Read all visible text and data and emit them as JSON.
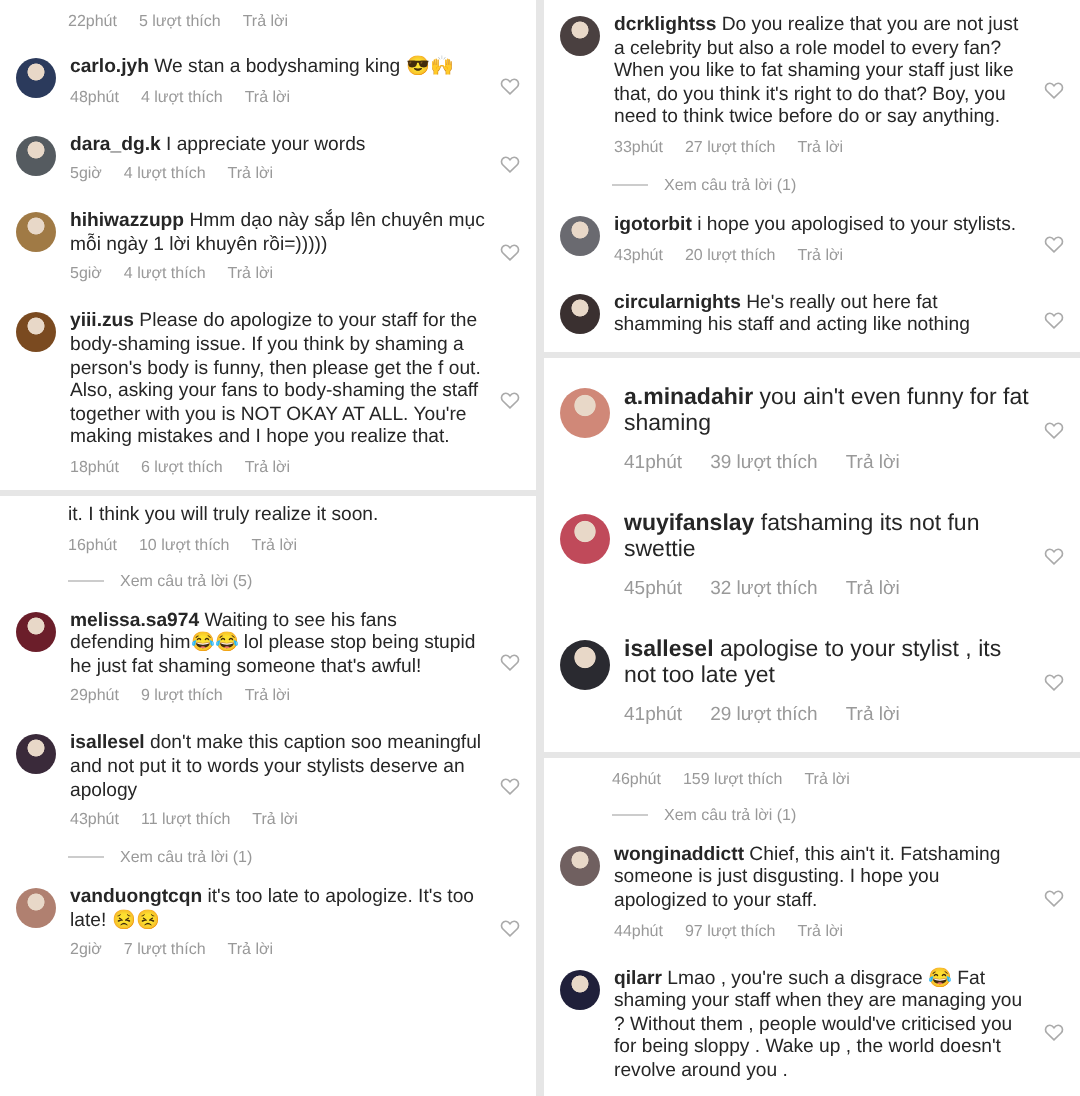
{
  "columns": [
    {
      "panels": [
        {
          "kind": "compact",
          "items": [
            {
              "kind": "meta",
              "time": "22phút",
              "likes": "5 lượt thích",
              "reply": "Trả lời"
            },
            {
              "kind": "comment",
              "user": "carlo.jyh",
              "text": "We stan a bodyshaming king 😎🙌",
              "time": "48phút",
              "likes": "4 lượt thích",
              "reply": "Trả lời"
            },
            {
              "kind": "comment",
              "user": "dara_dg.k",
              "text": "I appreciate your words",
              "time": "5giờ",
              "likes": "4 lượt thích",
              "reply": "Trả lời"
            },
            {
              "kind": "comment",
              "user": "hihiwazzupp",
              "text": "Hmm dạo này sắp lên chuyên mục mỗi ngày 1 lời khuyên rồi=)))))",
              "time": "5giờ",
              "likes": "4 lượt thích",
              "reply": "Trả lời"
            },
            {
              "kind": "comment",
              "user": "yiii.zus",
              "text": "Please do apologize to your staff for the body-shaming issue. If you think by shaming a person's body is funny, then please get the f out. Also, asking your fans to body-shaming the staff together with you is NOT OKAY AT ALL. You're making mistakes and I hope you realize that.",
              "time": "18phút",
              "likes": "6 lượt thích",
              "reply": "Trả lời"
            }
          ]
        },
        {
          "kind": "compact",
          "items": [
            {
              "kind": "fragment",
              "text": "it. I think you will truly realize it soon.",
              "time": "16phút",
              "likes": "10 lượt thích",
              "reply": "Trả lời"
            },
            {
              "kind": "replies",
              "text": "Xem câu trả lời (5)"
            },
            {
              "kind": "comment",
              "user": "melissa.sa974",
              "text": "Waiting to see his fans defending him😂😂 lol please stop being stupid he just fat shaming someone that's awful!",
              "time": "29phút",
              "likes": "9 lượt thích",
              "reply": "Trả lời"
            },
            {
              "kind": "comment",
              "user": "isallesel",
              "text": "don't make this caption soo meaningful and not put it to words your stylists deserve an apology",
              "time": "43phút",
              "likes": "11 lượt thích",
              "reply": "Trả lời"
            },
            {
              "kind": "replies",
              "text": "Xem câu trả lời (1)"
            },
            {
              "kind": "comment",
              "user": "vanduongtcqn",
              "text": "it's too late to apologize. It's too late! 😣😣",
              "time": "2giờ",
              "likes": "7 lượt thích",
              "reply": "Trả lời"
            }
          ]
        }
      ]
    },
    {
      "panels": [
        {
          "kind": "compact",
          "items": [
            {
              "kind": "comment",
              "user": "dcrklightss",
              "text": "Do you realize that you are not just a celebrity but also a role model to every fan? When you like to fat shaming your staff just like that, do you think it's right to do that? Boy, you need to think twice before do or say anything.",
              "time": "33phút",
              "likes": "27 lượt thích",
              "reply": "Trả lời"
            },
            {
              "kind": "replies",
              "text": "Xem câu trả lời (1)"
            },
            {
              "kind": "comment",
              "user": "igotorbit",
              "text": "i hope you apologised to your stylists.",
              "time": "43phút",
              "likes": "20 lượt thích",
              "reply": "Trả lời"
            },
            {
              "kind": "comment",
              "user": "circularnights",
              "text": "He's really out here fat shamming his staff and acting like nothing"
            }
          ]
        },
        {
          "kind": "large",
          "items": [
            {
              "kind": "comment",
              "user": "a.minadahir",
              "text": "you ain't even funny for fat shaming",
              "time": "41phút",
              "likes": "39 lượt thích",
              "reply": "Trả lời"
            },
            {
              "kind": "comment",
              "user": "wuyifanslay",
              "text": "fatshaming its not fun swettie",
              "time": "45phút",
              "likes": "32 lượt thích",
              "reply": "Trả lời"
            },
            {
              "kind": "comment",
              "user": "isallesel",
              "text": "apologise to your stylist , its not too late yet",
              "time": "41phút",
              "likes": "29 lượt thích",
              "reply": "Trả lời"
            }
          ]
        },
        {
          "kind": "compact",
          "items": [
            {
              "kind": "meta",
              "time": "46phút",
              "likes": "159 lượt thích",
              "reply": "Trả lời"
            },
            {
              "kind": "replies",
              "text": "Xem câu trả lời (1)"
            },
            {
              "kind": "comment",
              "user": "wonginaddictt",
              "text": "Chief, this ain't it. Fatshaming someone is just disgusting. I hope you apologized to your staff.",
              "time": "44phút",
              "likes": "97 lượt thích",
              "reply": "Trả lời"
            },
            {
              "kind": "comment",
              "user": "qilarr",
              "text": "Lmao , you're such a disgrace 😂 Fat shaming your staff when they are managing you ? Without them , people would've criticised you for being sloppy . Wake up , the world doesn't revolve around you ."
            }
          ]
        }
      ]
    }
  ]
}
